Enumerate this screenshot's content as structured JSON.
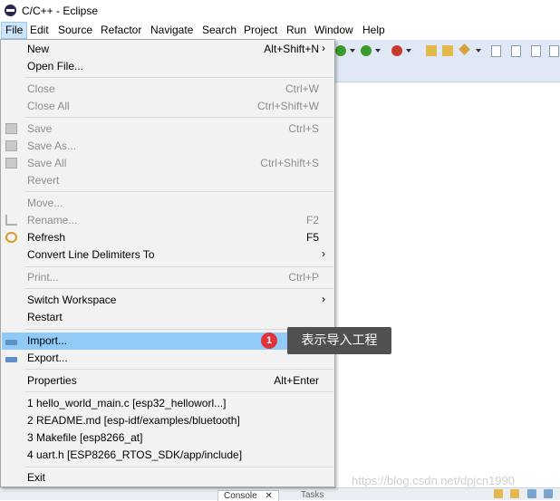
{
  "window": {
    "title": "C/C++ - Eclipse"
  },
  "menubar": {
    "items": [
      {
        "label": "File",
        "active": true
      },
      {
        "label": "Edit"
      },
      {
        "label": "Source"
      },
      {
        "label": "Refactor"
      },
      {
        "label": "Navigate"
      },
      {
        "label": "Search"
      },
      {
        "label": "Project"
      },
      {
        "label": "Run"
      },
      {
        "label": "Window"
      },
      {
        "label": "Help"
      }
    ]
  },
  "file_menu": {
    "items": [
      {
        "label": "New",
        "shortcut": "Alt+Shift+N",
        "submenu": "›",
        "enabled": true
      },
      {
        "label": "Open File...",
        "enabled": true
      },
      {
        "label": "Close",
        "shortcut": "Ctrl+W",
        "enabled": false
      },
      {
        "label": "Close All",
        "shortcut": "Ctrl+Shift+W",
        "enabled": false
      },
      {
        "label": "Save",
        "shortcut": "Ctrl+S",
        "enabled": false,
        "icon": "save-icon"
      },
      {
        "label": "Save As...",
        "enabled": false,
        "icon": "save-as-icon"
      },
      {
        "label": "Save All",
        "shortcut": "Ctrl+Shift+S",
        "enabled": false,
        "icon": "save-all-icon"
      },
      {
        "label": "Revert",
        "enabled": false
      },
      {
        "label": "Move...",
        "enabled": false
      },
      {
        "label": "Rename...",
        "shortcut": "F2",
        "enabled": false,
        "icon": "rename-icon"
      },
      {
        "label": "Refresh",
        "shortcut": "F5",
        "enabled": true,
        "icon": "refresh-icon"
      },
      {
        "label": "Convert Line Delimiters To",
        "submenu": "›",
        "enabled": true
      },
      {
        "label": "Print...",
        "shortcut": "Ctrl+P",
        "enabled": false
      },
      {
        "label": "Switch Workspace",
        "submenu": "›",
        "enabled": true
      },
      {
        "label": "Restart",
        "enabled": true
      },
      {
        "label": "Import...",
        "enabled": true,
        "highlighted": true,
        "icon": "import-icon"
      },
      {
        "label": "Export...",
        "enabled": true,
        "icon": "export-icon"
      },
      {
        "label": "Properties",
        "shortcut": "Alt+Enter",
        "enabled": true
      },
      {
        "label": "1 hello_world_main.c  [esp32_helloworl...]",
        "enabled": true
      },
      {
        "label": "2 README.md  [esp-idf/examples/bluetooth]",
        "enabled": true
      },
      {
        "label": "3 Makefile  [esp8266_at]",
        "enabled": true
      },
      {
        "label": "4 uart.h  [ESP8266_RTOS_SDK/app/include]",
        "enabled": true
      },
      {
        "label": "Exit",
        "enabled": true
      }
    ]
  },
  "annotation": {
    "badge": "1",
    "text": "表示导入工程"
  },
  "bottom_tabs": {
    "console": "Console",
    "tasks": "Tasks",
    "close_glyph": "✕"
  },
  "watermark": "https://blog.csdn.net/dpjcn1990",
  "colors": {
    "highlight": "#91c9f7",
    "menu_bg": "#f2f2f2",
    "toolbar_bg": "#dfe8f4",
    "badge": "#e0323c",
    "callout": "#505050"
  }
}
